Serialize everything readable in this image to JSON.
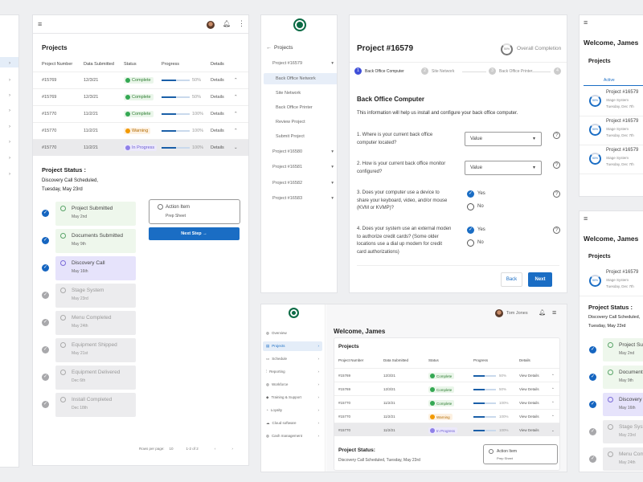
{
  "colors": {
    "primary": "#1a6dc4",
    "complete": "#34a853",
    "warning": "#f29900",
    "in_progress": "#8f80e8",
    "background": "#eeeff1"
  },
  "table": {
    "title": "Projects",
    "headers": [
      "Project Number",
      "Data Submitted",
      "Status",
      "Progress",
      "Details"
    ],
    "rows": [
      {
        "number": "#15769",
        "date": "12/3/21",
        "status": "Complete",
        "kind": "complete",
        "progress": 50,
        "progress_label": "50%",
        "details": "Details",
        "view_details": "View Details",
        "chev": "^"
      },
      {
        "number": "#15769",
        "date": "12/3/21",
        "status": "Complete",
        "kind": "complete",
        "progress": 50,
        "progress_label": "50%",
        "details": "Details",
        "view_details": "View Details",
        "chev": "^"
      },
      {
        "number": "#15770",
        "date": "11/2/21",
        "status": "Complete",
        "kind": "complete",
        "progress": 50,
        "progress_label": "100%",
        "details": "Details",
        "view_details": "View Details",
        "chev": "^"
      },
      {
        "number": "#15770",
        "date": "11/2/21",
        "status": "Warning",
        "kind": "warning",
        "progress": 50,
        "progress_label": "100%",
        "details": "Details",
        "view_details": "View Details",
        "chev": "^"
      },
      {
        "number": "#15770",
        "date": "11/2/21",
        "status": "In Progress",
        "kind": "progress",
        "progress": 50,
        "progress_label": "100%",
        "details": "Details",
        "view_details": "View Details",
        "chev": "v"
      }
    ]
  },
  "status": {
    "title": "Project Status :",
    "title_alt": "Project Status:",
    "line1": "Discovery Call Scheduled,",
    "line2": "Tuesday, May  23rd",
    "full": "Discovery Call Scheduled, Tuesday, May  23rd",
    "timeline": [
      {
        "title": "Project Submitted",
        "date": "May 2nd",
        "state": "green"
      },
      {
        "title": "Documents Submitted",
        "date": "May 9th",
        "state": "green"
      },
      {
        "title": "Discovery Call",
        "date": "May 16th",
        "state": "purple"
      },
      {
        "title": "Stage System",
        "date": "May 23rd",
        "state": "gray"
      },
      {
        "title": "Menu Completed",
        "date": "May 24th",
        "state": "gray"
      },
      {
        "title": "Equipment Shipped",
        "date": "May 21st",
        "state": "gray"
      },
      {
        "title": "Equipment Delivered",
        "date": "Dec 6th",
        "state": "gray"
      },
      {
        "title": "Install Completed",
        "date": "Dec 18th",
        "state": "gray"
      }
    ],
    "action_title": "Action Item",
    "action_sub": "Prep Sheet",
    "next_step": "Next Step →"
  },
  "pagination": {
    "rows_label": "Rows per page:",
    "rows_value": "10",
    "range": "1-2 of 2"
  },
  "project_nav": {
    "back": "Projects",
    "projects": [
      "Project #16579",
      "Project #16580",
      "Project #16581",
      "Project #16582",
      "Project #16583"
    ],
    "sub": [
      "Back Office Network",
      "Site Network",
      "Back Office Printer",
      "Review Project",
      "Submit Project"
    ]
  },
  "form": {
    "title": "Project #16579",
    "completion_pct": "50%",
    "completion_label": "Overall Completion",
    "steps": [
      "Back Office Computer",
      "Site Network",
      "Back Office Printer"
    ],
    "step_nums": [
      "1",
      "2",
      "3",
      "4"
    ],
    "section": "Back Office Computer",
    "intro": "This information will help us install and configure your back office computer.",
    "q1": "1. Where is your current back office computer located?",
    "q2": "2. How is your current back office monitor configured?",
    "q3": "3. Does your computer use a device to share your keyboard, video, and/or mouse (KVM or KVMP)?",
    "q4": "4. Does your system use an external moden to authorize credit cards? (Some older locations use a dial up modem for credit card authorizations)",
    "select_value": "Value",
    "yes": "Yes",
    "no": "No",
    "back": "Back",
    "next": "Next"
  },
  "dashboard": {
    "user": "Tom Jones",
    "welcome": "Welcome, James",
    "nav": [
      "Overview",
      "Projects",
      "Schedule",
      "Reporting",
      "Workforce",
      "Training & Support",
      "Loyalty",
      "Cloud software",
      "Cash management"
    ]
  },
  "mobile": {
    "welcome": "Welcome, James",
    "projects": "Projects",
    "tab": "Active",
    "cards": [
      {
        "title": "Project #16579",
        "stage": "Stage System",
        "date": "Tuesday, Dec 7th",
        "pct": "50%"
      },
      {
        "title": "Project #16579",
        "stage": "Stage System",
        "date": "Tuesday, Dec 7th",
        "pct": "50%"
      },
      {
        "title": "Project #16579",
        "stage": "Stage System",
        "date": "Tuesday, Dec 7th",
        "pct": "50%"
      }
    ]
  }
}
